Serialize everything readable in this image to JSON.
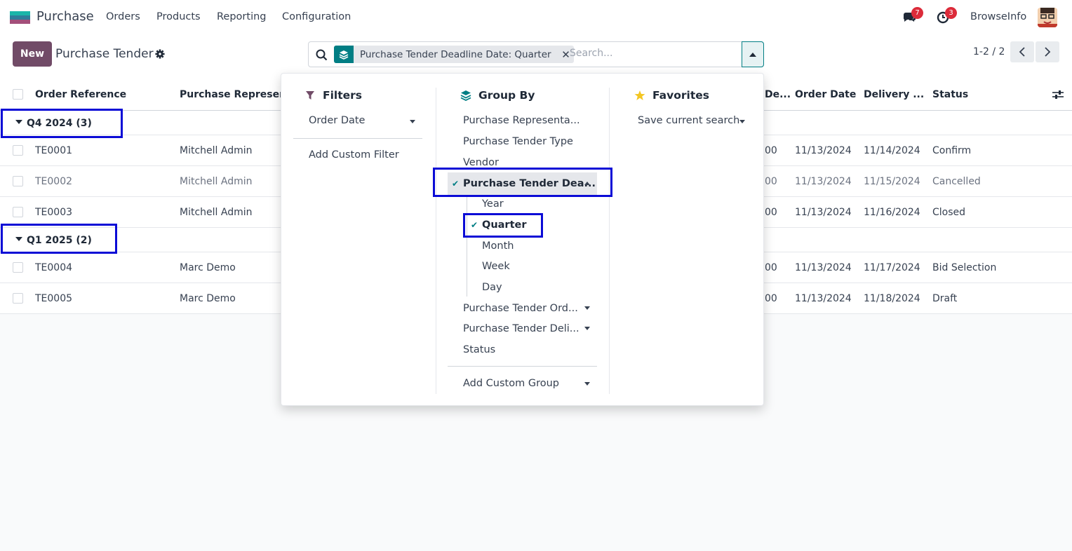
{
  "nav": {
    "app_name": "Purchase",
    "menu": [
      "Orders",
      "Products",
      "Reporting",
      "Configuration"
    ],
    "messages_count": "7",
    "activities_count": "3",
    "company": "BrowseInfo"
  },
  "control": {
    "new_label": "New",
    "title": "Purchase Tender",
    "facet_label": "Purchase Tender Deadline Date: Quarter",
    "search_placeholder": "Search...",
    "pager": "1-2 / 2"
  },
  "list": {
    "columns": [
      "Order Reference",
      "Purchase Represent",
      "De...",
      "Order Date",
      "Delivery ...",
      "Status"
    ],
    "groups": [
      {
        "label": "Q4 2024 (3)",
        "rows": [
          {
            "ref": "TE0001",
            "rep": "Mitchell Admin",
            "deadline": "00",
            "order_date": "11/13/2024",
            "delivery": "11/14/2024",
            "status": "Confirm"
          },
          {
            "ref": "TE0002",
            "rep": "Mitchell Admin",
            "deadline": "00",
            "order_date": "11/13/2024",
            "delivery": "11/15/2024",
            "status": "Cancelled"
          },
          {
            "ref": "TE0003",
            "rep": "Mitchell Admin",
            "deadline": "00",
            "order_date": "11/13/2024",
            "delivery": "11/16/2024",
            "status": "Closed"
          }
        ]
      },
      {
        "label": "Q1 2025 (2)",
        "rows": [
          {
            "ref": "TE0004",
            "rep": "Marc Demo",
            "deadline": "00",
            "order_date": "11/13/2024",
            "delivery": "11/17/2024",
            "status": "Bid Selection"
          },
          {
            "ref": "TE0005",
            "rep": "Marc Demo",
            "deadline": "00",
            "order_date": "11/13/2024",
            "delivery": "11/18/2024",
            "status": "Draft"
          }
        ]
      }
    ]
  },
  "dropdown": {
    "filters": {
      "title": "Filters",
      "order_date": "Order Date",
      "add_custom": "Add Custom Filter"
    },
    "group_by": {
      "title": "Group By",
      "representative": "Purchase Representa...",
      "tender_type": "Purchase Tender Type",
      "vendor": "Vendor",
      "deadline": "Purchase Tender Dea...",
      "intervals": [
        "Year",
        "Quarter",
        "Month",
        "Week",
        "Day"
      ],
      "order_date": "Purchase Tender Ord...",
      "delivery_date": "Purchase Tender Deli...",
      "status": "Status",
      "add_custom": "Add Custom Group"
    },
    "favorites": {
      "title": "Favorites",
      "save": "Save current search"
    }
  }
}
